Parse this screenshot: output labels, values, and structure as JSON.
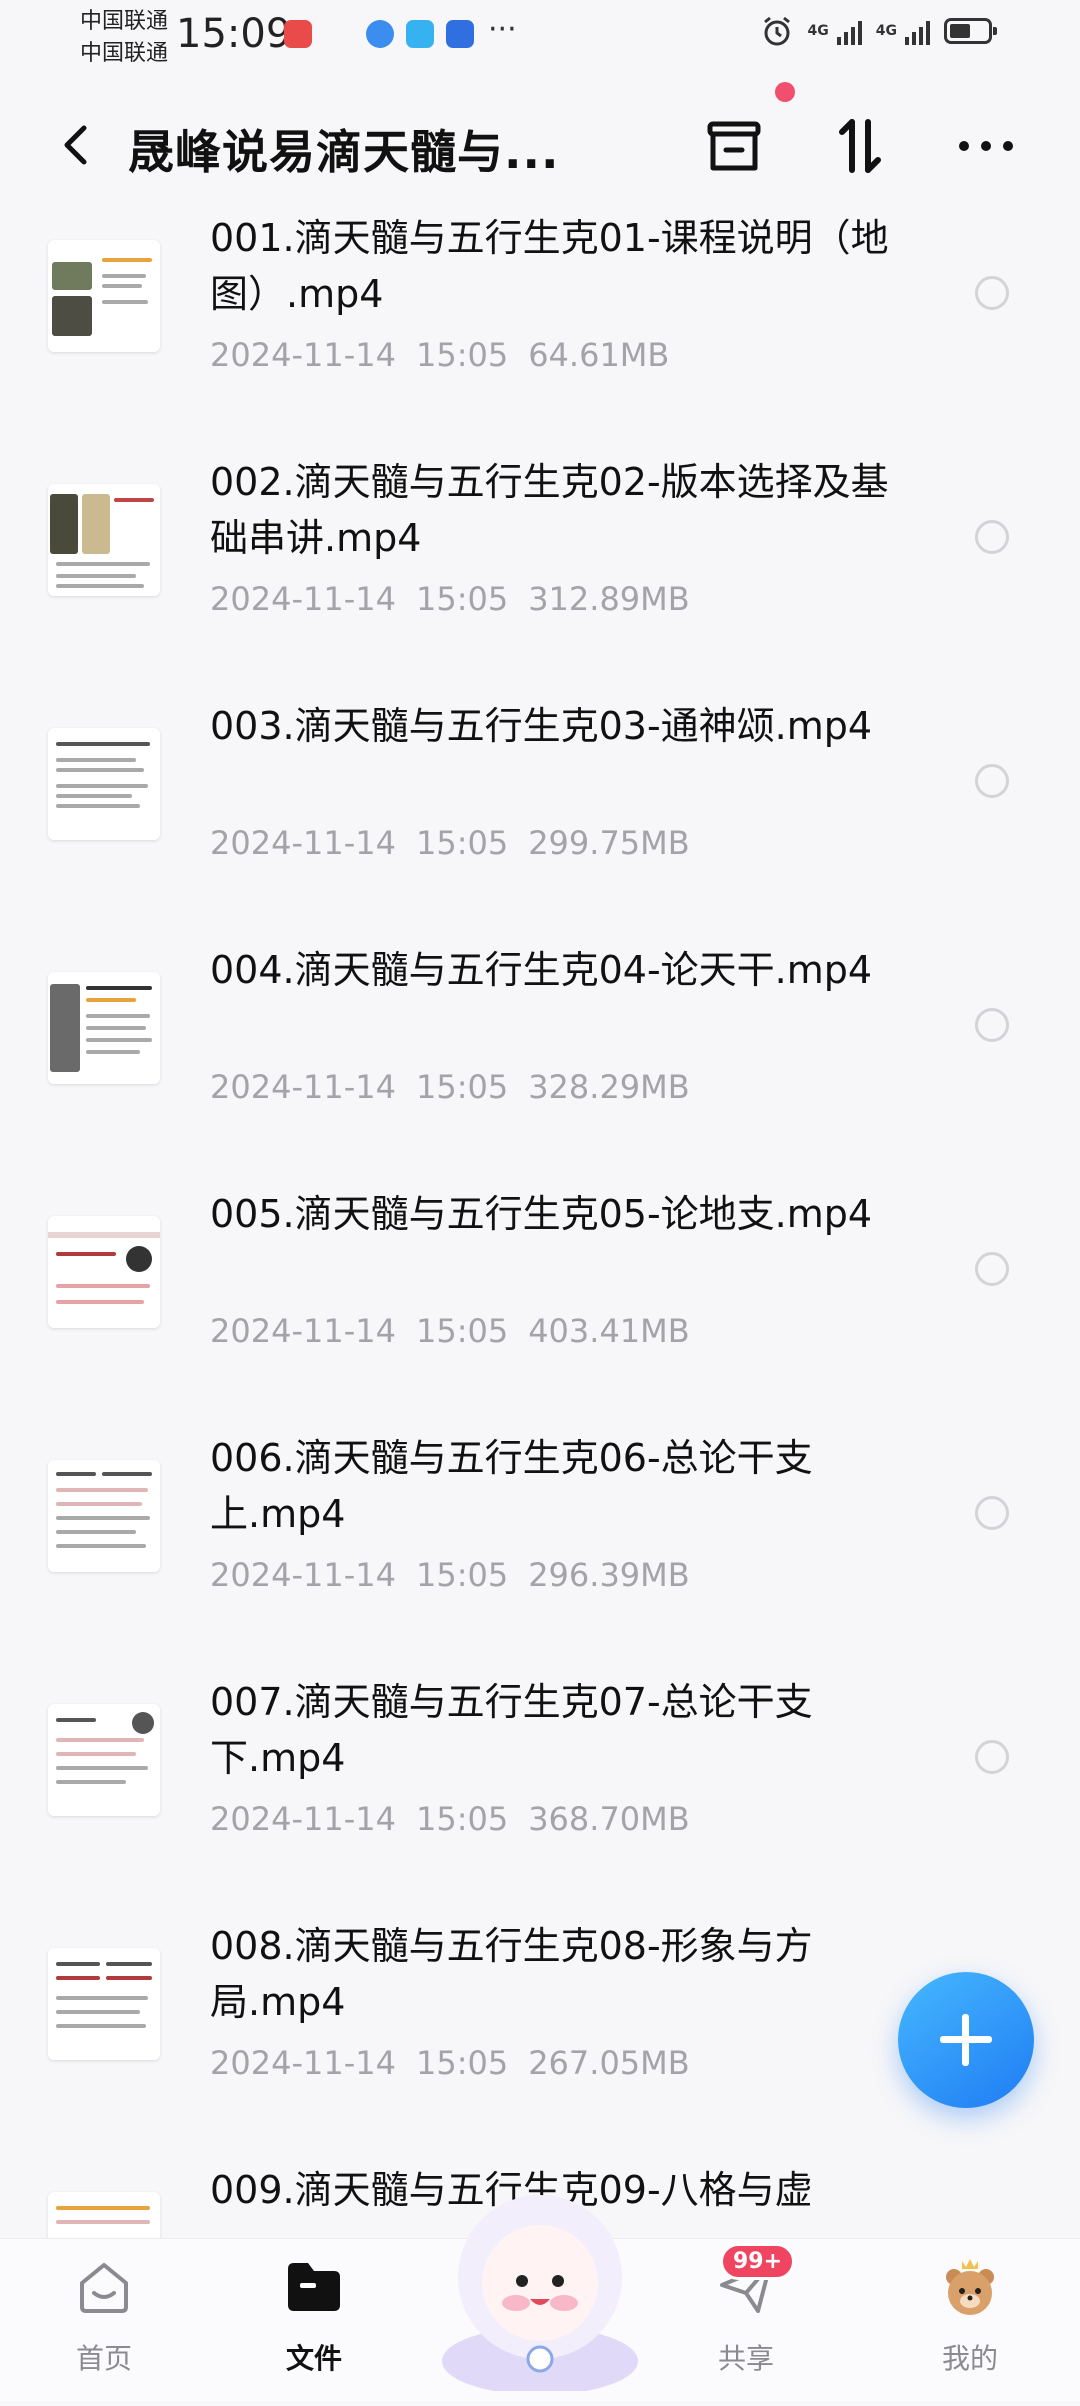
{
  "status_bar": {
    "carrier_1": "中国联通",
    "carrier_2": "中国联通",
    "time": "15:09",
    "network_1": "4G",
    "network_2": "4G",
    "battery_level": 0.55
  },
  "header": {
    "title": "晟峰说易滴天髓与..."
  },
  "files": [
    {
      "name": "001.滴天髓与五行生克01-课程说明（地图）.mp4",
      "date": "2024-11-14",
      "time": "15:05",
      "size": "64.61MB"
    },
    {
      "name": "002.滴天髓与五行生克02-版本选择及基础串讲.mp4",
      "date": "2024-11-14",
      "time": "15:05",
      "size": "312.89MB"
    },
    {
      "name": "003.滴天髓与五行生克03-通神颂.mp4",
      "date": "2024-11-14",
      "time": "15:05",
      "size": "299.75MB"
    },
    {
      "name": "004.滴天髓与五行生克04-论天干.mp4",
      "date": "2024-11-14",
      "time": "15:05",
      "size": "328.29MB"
    },
    {
      "name": "005.滴天髓与五行生克05-论地支.mp4",
      "date": "2024-11-14",
      "time": "15:05",
      "size": "403.41MB"
    },
    {
      "name": "006.滴天髓与五行生克06-总论干支上.mp4",
      "date": "2024-11-14",
      "time": "15:05",
      "size": "296.39MB"
    },
    {
      "name": "007.滴天髓与五行生克07-总论干支下.mp4",
      "date": "2024-11-14",
      "time": "15:05",
      "size": "368.70MB"
    },
    {
      "name": "008.滴天髓与五行生克08-形象与方局.mp4",
      "date": "2024-11-14",
      "time": "15:05",
      "size": "267.05MB"
    },
    {
      "name": "009.滴天髓与五行生克09-八格与虚",
      "date": "",
      "time": "",
      "size": ""
    }
  ],
  "bottom_nav": {
    "home": "首页",
    "files": "文件",
    "share": "共享",
    "share_badge": "99+",
    "me": "我的"
  },
  "colors": {
    "accent_blue": "#2a8cf6",
    "badge_red": "#f04560",
    "meta_gray": "#a3a3a9"
  }
}
